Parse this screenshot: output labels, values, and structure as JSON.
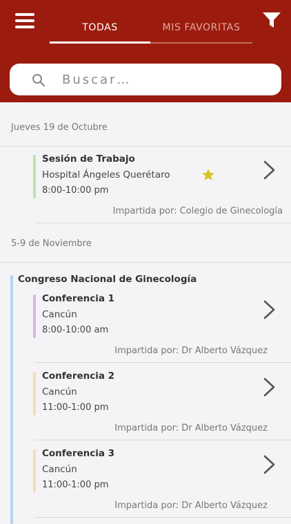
{
  "header": {
    "tabs": [
      {
        "label": "TODAS",
        "active": true
      },
      {
        "label": "MIS FAVORITAS",
        "active": false
      }
    ],
    "brand_color": "#9b1c0e",
    "menu_icon": "hamburger-icon",
    "filter_icon": "funnel-icon"
  },
  "search": {
    "placeholder": "Buscar…"
  },
  "sections": [
    {
      "date": "Jueves 19 de Octubre",
      "events": [
        {
          "title": "Sesión de Trabajo",
          "place": "Hospital Ángeles Querétaro",
          "time": "8:00-10:00 pm",
          "by": "Impartida por: Colegio de Ginecología",
          "color": "#b9e6a8",
          "favorite": true
        }
      ]
    },
    {
      "date": "5-9 de Noviembre",
      "group_title": "Congreso Nacional de Ginecología",
      "group_color": "#b8d2f2",
      "events": [
        {
          "title": "Conferencia 1",
          "place": "Cancún",
          "time": "8:00-10:00 am",
          "by": "Impartida por: Dr Alberto Vázquez",
          "color": "#d7b6ea",
          "favorite": false
        },
        {
          "title": "Conferencia 2",
          "place": "Cancún",
          "time": "11:00-1:00 pm",
          "by": "Impartida por: Dr Alberto Vázquez",
          "color": "#f6dcb4",
          "favorite": false
        },
        {
          "title": "Conferencia 3",
          "place": "Cancún",
          "time": "11:00-1:00 pm",
          "by": "Impartida por: Dr Alberto Vázquez",
          "color": "#f6dcb4",
          "favorite": false
        }
      ]
    }
  ]
}
